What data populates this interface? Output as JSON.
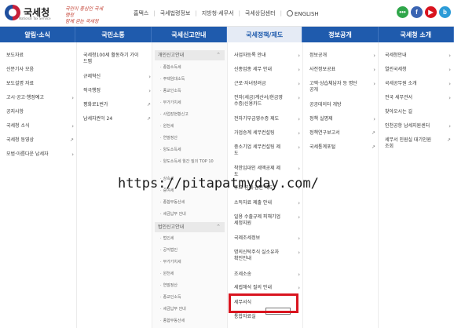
{
  "header": {
    "logo_text": "국세청",
    "logo_sub": "National Tax Service",
    "slogan_line1": "국민이 중심인 국세행정",
    "slogan_line2": "함께 걷는 국세청"
  },
  "util_nav": [
    "홈택스",
    "국세법령정보",
    "지방청·세무서",
    "국세상담센터",
    "ENGLISH"
  ],
  "social": [
    {
      "name": "chat",
      "glyph": "•••",
      "color": "#2fa64a"
    },
    {
      "name": "facebook",
      "glyph": "f",
      "color": "#3a64b2"
    },
    {
      "name": "youtube",
      "glyph": "▶",
      "color": "#d9141f"
    },
    {
      "name": "blog",
      "glyph": "b",
      "color": "#2b9bd7"
    }
  ],
  "main_nav": [
    "알림·소식",
    "국민소통",
    "국세신고안내",
    "국세정책/제도",
    "정보공개",
    "국세청 소개"
  ],
  "col1": [
    "보도자료",
    "신문기사 모음",
    "보도설명 자료",
    "고시·공고·행정예고",
    "공지사항",
    "국세청 소식",
    "국세청 동영상",
    "모범·아름다운 납세자"
  ],
  "col2": [
    "국세청100세 활동하기 가이드맵",
    "규제혁신",
    "적극행정",
    "평화로1번가",
    "납세자권익 24"
  ],
  "col3": {
    "personal_head": "개인신고안내",
    "personal": [
      "종합소득세",
      "주택임대소득",
      "종교인소득",
      "부가가치세",
      "사업장현황신고",
      "원천세",
      "연말정산",
      "양도소득세",
      "양도소득세 월간 질의 TOP 10",
      "상속세",
      "증여세",
      "종합부동산세",
      "세금납부 안내"
    ],
    "corp_head": "법인신고안내",
    "corp": [
      "법인세",
      "공익법인",
      "부가가치세",
      "원천세",
      "연말정산",
      "종교인소득",
      "세금납부 안내",
      "종합부동산세"
    ]
  },
  "col4": [
    "사업자등록 안내",
    "신종업종 세무 안내",
    "근로·자녀장려금",
    "전자(세금)계산서/현금영수증/신용카드",
    "전자기부금영수증 제도",
    "가업승계 세무컨설팅",
    "중소기업 세무컨설팅 제도",
    "착한임대인 세액공제 제도",
    "주요 공제·감면 제도",
    "소득자료 제출 안내",
    "일용 수출규제 피해기업 세정지원",
    "국제조세정보",
    "명의신탁주식 실소유자 확인안내",
    "조세소송",
    "세법해석 질의 안내",
    "세무서식",
    "통합자료실"
  ],
  "col5": [
    "정보공개",
    "사전정보공표",
    "고액·상습체납자 등 명단 공개",
    "공공데이터 개방",
    "정책 실명제",
    "정책연구보고서",
    "국세통계포털"
  ],
  "col6": [
    "국세청안내",
    "열린국세청",
    "국세공무원 소개",
    "전국 세무관서",
    "찾아오시는 길",
    "인천공항 납세지원센터",
    "세무서 민원실 대기인원조회"
  ],
  "watermark": "https://pitapatmyday.com/"
}
